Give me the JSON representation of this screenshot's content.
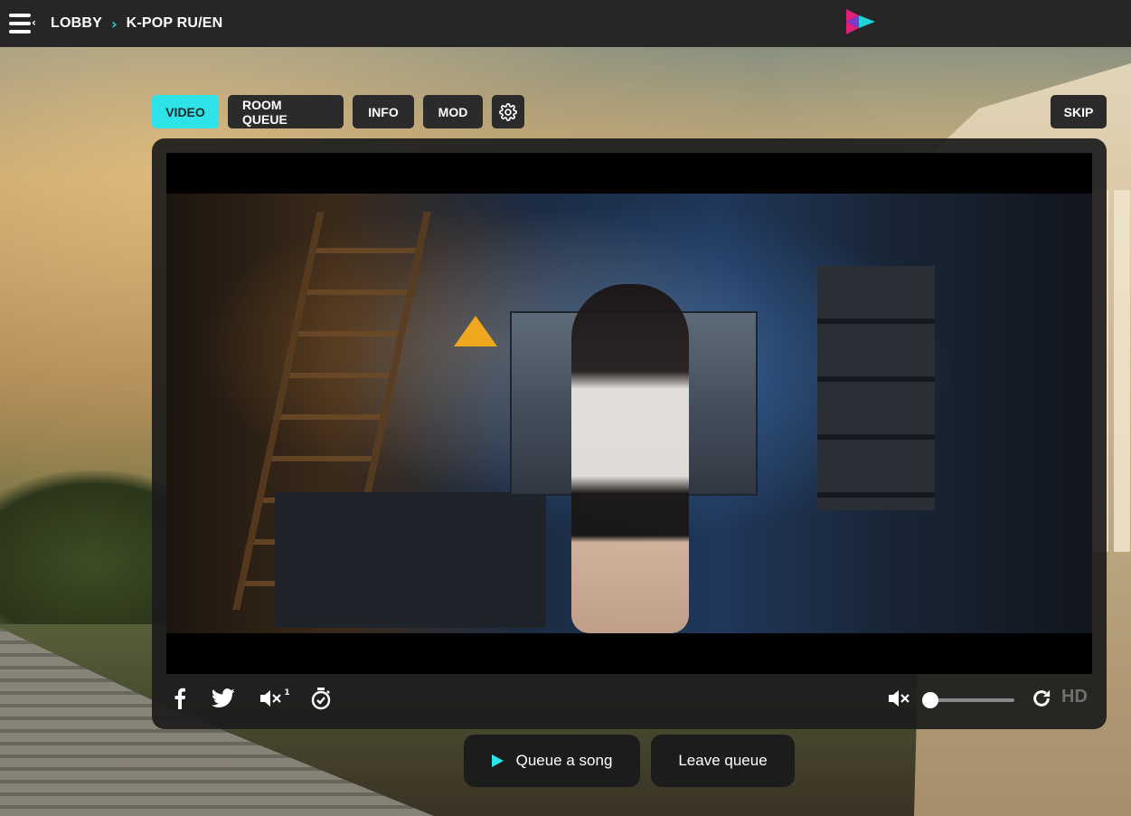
{
  "header": {
    "breadcrumb": [
      "LOBBY",
      "K-POP RU/EN"
    ],
    "menu_icon": "hamburger-collapse-icon",
    "logo": "brand-logo-triangles"
  },
  "tabs": [
    {
      "label": "VIDEO",
      "active": true
    },
    {
      "label": "ROOM QUEUE",
      "active": false
    },
    {
      "label": "INFO",
      "active": false
    },
    {
      "label": "MOD",
      "active": false
    }
  ],
  "settings_icon": "gear-icon",
  "skip_label": "SKIP",
  "player": {
    "controls": {
      "icons": [
        "facebook-icon",
        "twitter-icon",
        "mute-one-icon",
        "timer-icon",
        "mute-icon",
        "refresh-icon"
      ],
      "mute_badge": "1",
      "volume_level": 0,
      "hd_label": "HD"
    }
  },
  "actions": {
    "queue_label": "Queue a song",
    "leave_label": "Leave queue"
  },
  "colors": {
    "accent": "#2ee3e8",
    "topbar": "#262626",
    "button_bg": "#2b2b2b",
    "logo_pink": "#e0207a",
    "logo_cyan": "#1fd3d8"
  }
}
